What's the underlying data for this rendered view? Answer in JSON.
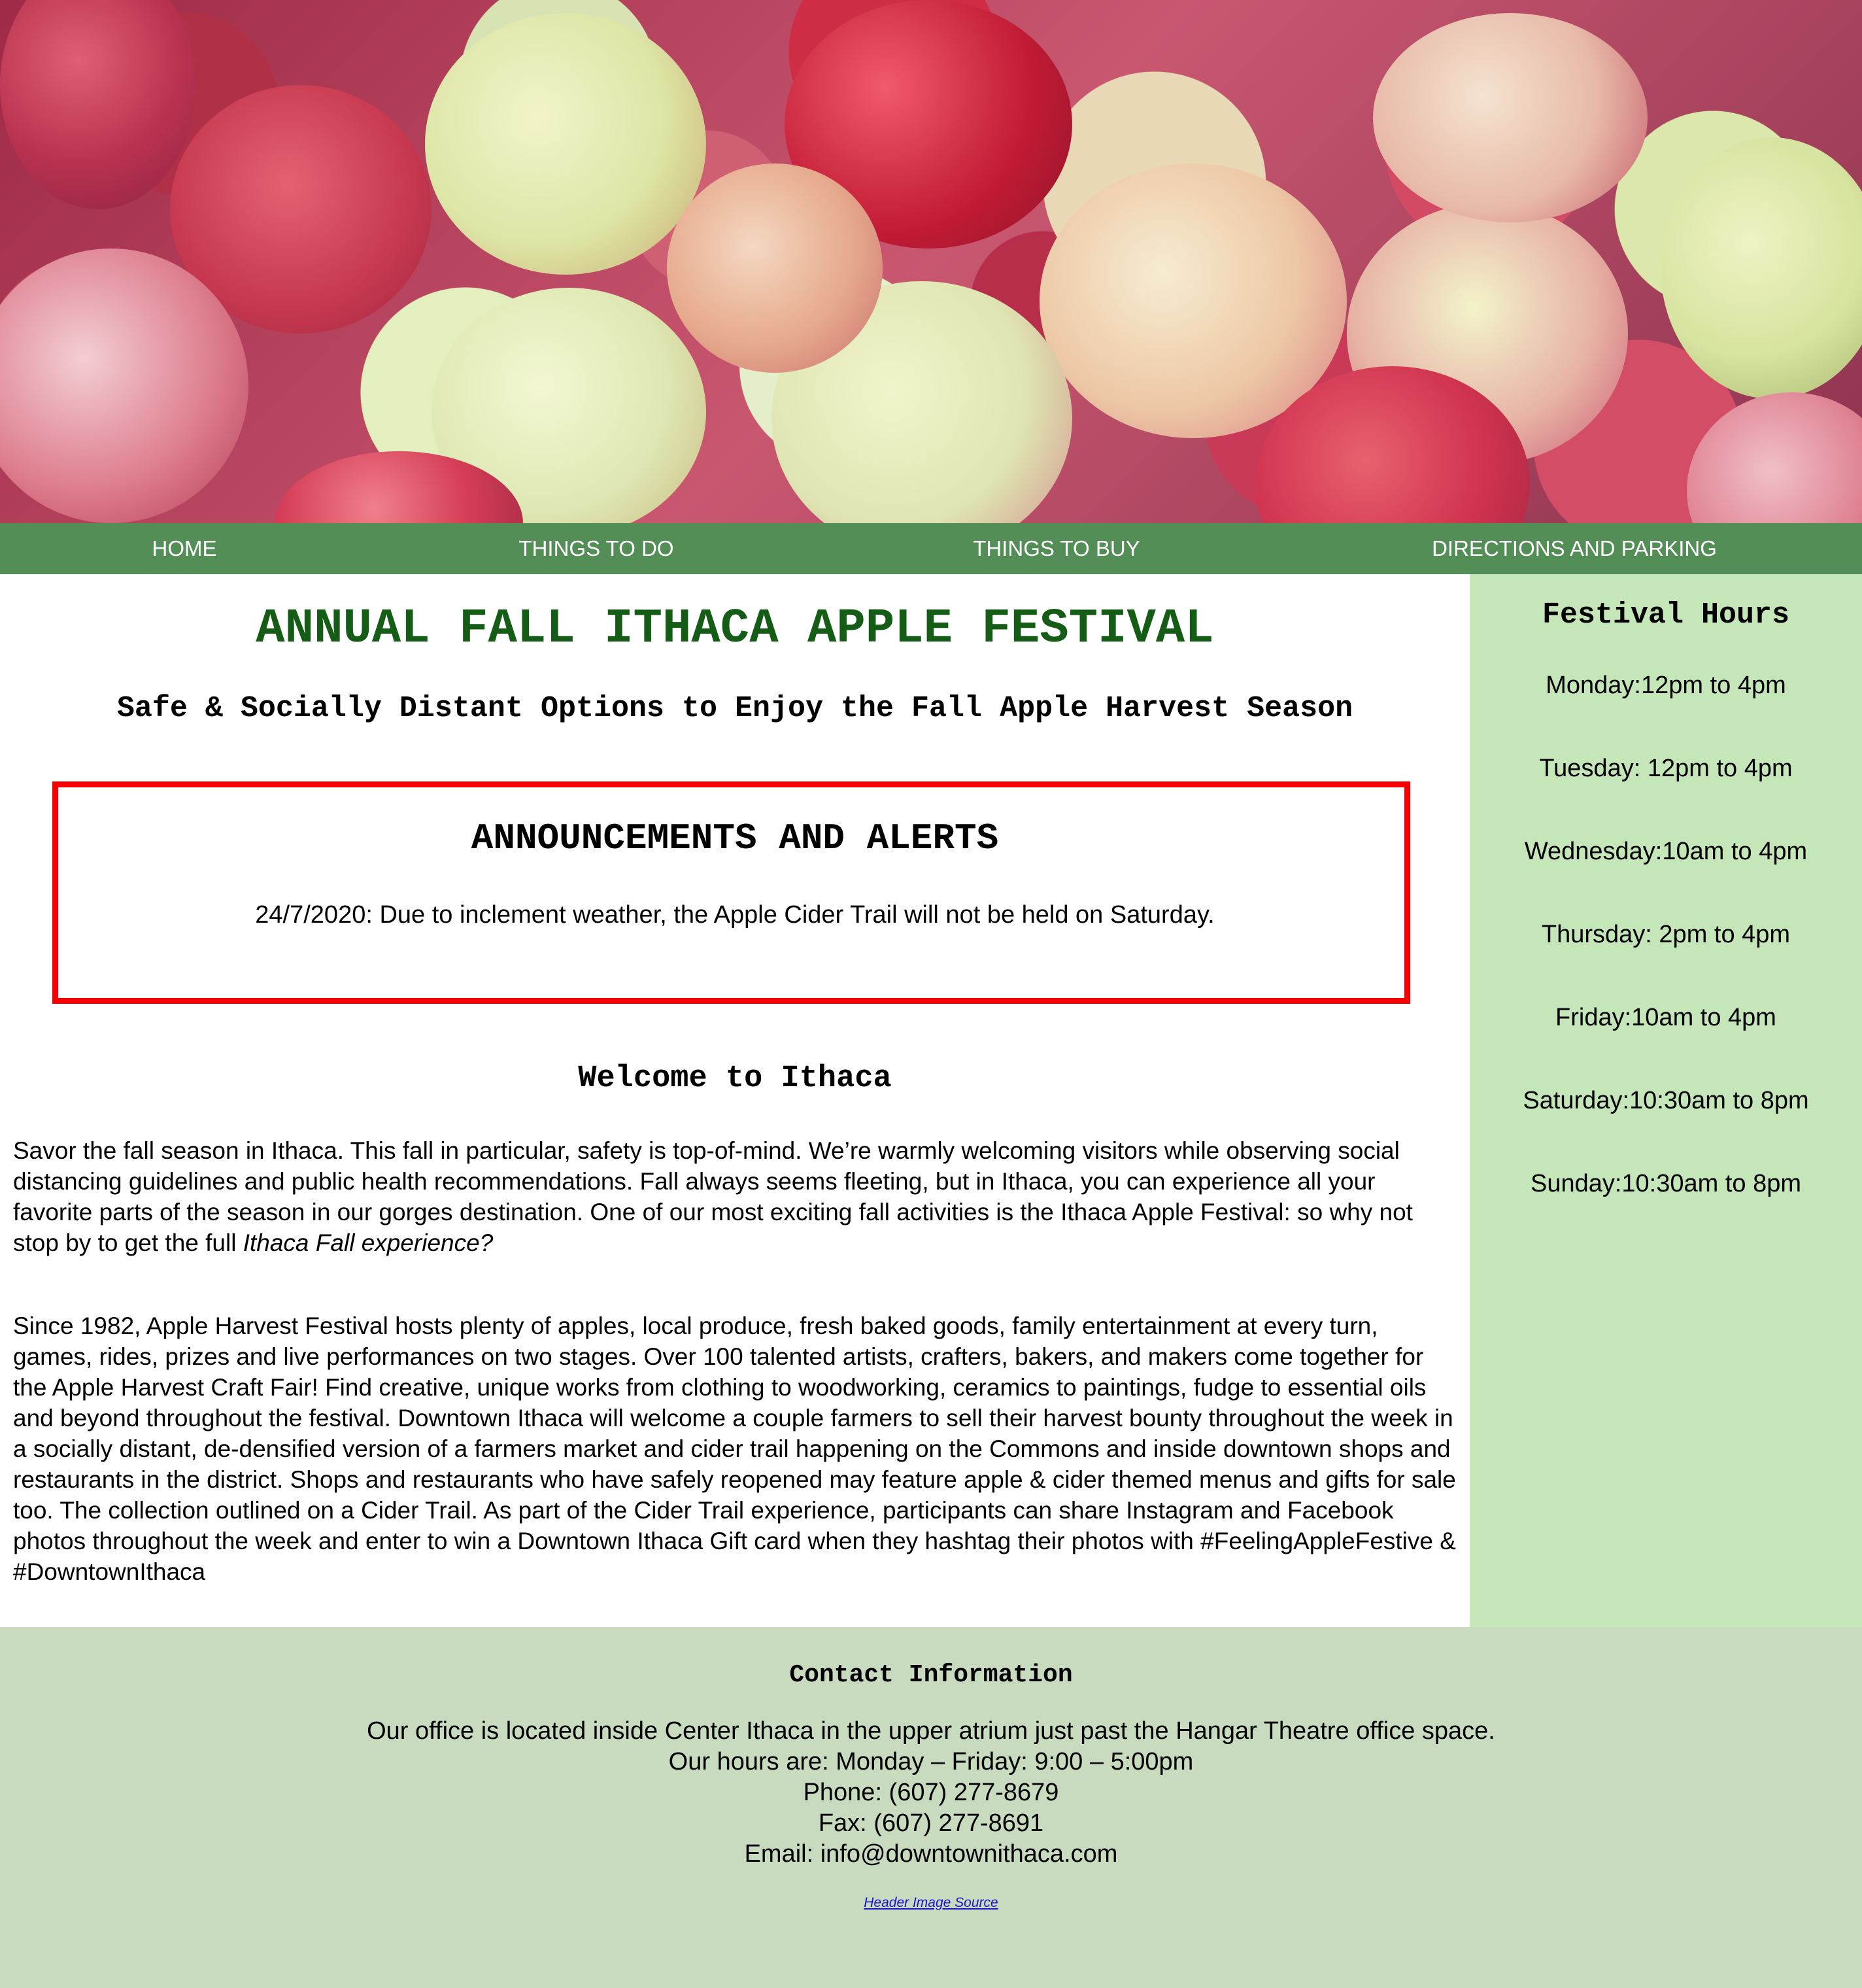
{
  "nav": {
    "items": [
      {
        "label": "HOME"
      },
      {
        "label": "THINGS TO DO"
      },
      {
        "label": "THINGS TO BUY"
      },
      {
        "label": "DIRECTIONS AND PARKING"
      }
    ]
  },
  "main": {
    "title": "ANNUAL FALL ITHACA APPLE FESTIVAL",
    "subtitle": "Safe & Socially Distant Options to Enjoy the Fall Apple Harvest Season",
    "alerts": {
      "heading": "ANNOUNCEMENTS AND ALERTS",
      "text": "24/7/2020: Due to inclement weather, the Apple Cider Trail will not be held on Saturday."
    },
    "welcome": {
      "heading": "Welcome to Ithaca",
      "para1_text": "Savor the fall season in Ithaca. This fall in particular, safety is top-of-mind. We’re warmly welcoming visitors while observing social distancing guidelines and public health recommendations. Fall always seems fleeting, but in Ithaca, you can experience all your favorite parts of the season in our gorges destination. One of our most exciting fall activities is the Ithaca Apple Festival: so why not stop by to get the full ",
      "para1_emphasis": "Ithaca Fall experience?",
      "para2_text": "Since 1982, Apple Harvest Festival hosts plenty of apples, local produce, fresh baked goods, family entertainment at every turn, games, rides, prizes and live performances on two stages. Over 100 talented artists, crafters, bakers, and makers come together for the Apple Harvest Craft Fair! Find creative, unique works from clothing to woodworking, ceramics to paintings, fudge to essential oils and beyond throughout the festival. Downtown Ithaca will welcome a couple farmers to sell their harvest bounty throughout the week in a socially distant, de-densified version of a farmers market and cider trail happening on the Commons and inside downtown shops and restaurants in the district. Shops and restaurants who have safely reopened may feature apple & cider themed menus and gifts for sale too. The collection outlined on a Cider Trail. As part of the Cider Trail experience, participants can share Instagram and Facebook photos throughout the week and enter to win a Downtown Ithaca Gift card when they hashtag their photos with #FeelingAppleFestive & #DowntownIthaca"
    }
  },
  "sidebar": {
    "heading": "Festival Hours",
    "hours": [
      "Monday:12pm to 4pm",
      "Tuesday: 12pm to 4pm",
      "Wednesday:10am to 4pm",
      "Thursday: 2pm to 4pm",
      "Friday:10am to 4pm",
      "Saturday:10:30am to 8pm",
      "Sunday:10:30am to 8pm"
    ]
  },
  "footer": {
    "heading": "Contact Information",
    "lines": [
      "Our office is located inside Center Ithaca in the upper atrium just past the Hangar Theatre office space.",
      "Our hours are: Monday – Friday: 9:00 – 5:00pm",
      "Phone: (607) 277-8679",
      "Fax: (607) 277-8691",
      "Email: info@downtownithaca.com"
    ],
    "source_link": "Header Image Source"
  },
  "colors": {
    "nav_bg": "#548e57",
    "title_green": "#155c17",
    "sidebar_bg": "#c5e6b9",
    "footer_bg": "#c8dbbf",
    "alert_border": "#f80000",
    "link_blue": "#1a14c8"
  }
}
